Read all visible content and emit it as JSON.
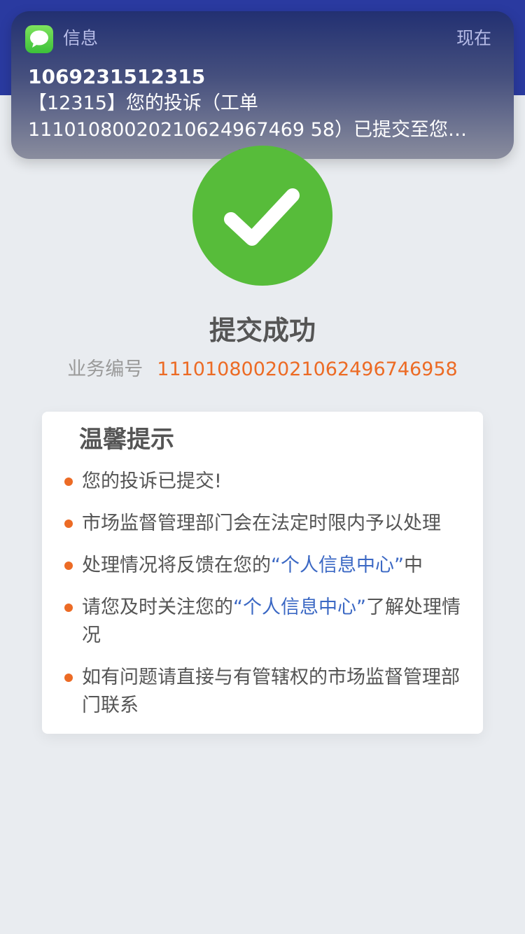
{
  "notification": {
    "app_name": "信息",
    "time": "现在",
    "sender": "1069231512315",
    "body_line1": "【12315】您的投诉（工单",
    "body_line2": "11101080020210624967469 58）已提交至您…"
  },
  "result": {
    "title": "提交成功",
    "biz_label": "业务编号",
    "biz_number": "1110108002021062496746958"
  },
  "tips": {
    "title": "温馨提示",
    "items": [
      {
        "text": "您的投诉已提交!"
      },
      {
        "text": "市场监督管理部门会在法定时限内予以处理"
      },
      {
        "pre": "处理情况将反馈在您的",
        "link": "“个人信息中心”",
        "post": "中"
      },
      {
        "pre": "请您及时关注您的",
        "link": "“个人信息中心”",
        "post": "了解处理情况"
      },
      {
        "text": "如有问题请直接与有管辖权的市场监督管理部门联系"
      }
    ]
  },
  "colors": {
    "accent_orange": "#ec6b25",
    "success_green": "#57bc3a",
    "link_blue": "#3b68c4",
    "header_blue": "#2a3aa0"
  },
  "icons": {
    "app": "messages-icon",
    "success": "checkmark-icon",
    "bullet": "bullet-dot-icon"
  }
}
